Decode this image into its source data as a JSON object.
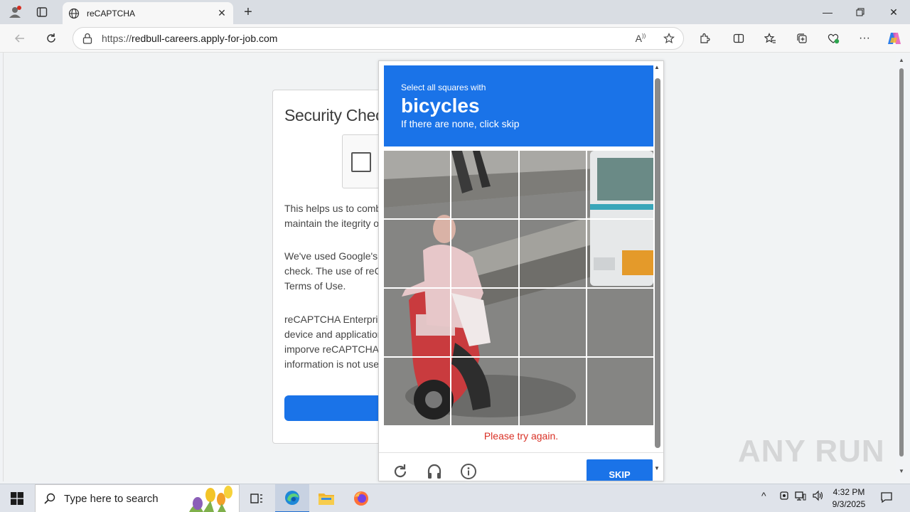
{
  "browser": {
    "tab_title": "reCAPTCHA",
    "url_prefix": "https://",
    "url_host": "redbull-careers.apply-for-job.com"
  },
  "page": {
    "card_title": "Security Check",
    "para1_line1": "This helps us to comba",
    "para1_line2": "maintain the itegrity of",
    "para2_line1": "We've used Google's r",
    "para2_line2": "check. The use of reCA",
    "para2_line3": "Terms of Use.",
    "para3_line1": "reCAPTCHA Enterpris",
    "para3_line2": "device and application",
    "para3_line3": "imporve reCAPTCHA l",
    "para3_line4": "information is not used"
  },
  "challenge": {
    "instruction": "Select all squares with",
    "keyword": "bicycles",
    "hint": "If there are none, click skip",
    "error": "Please try again.",
    "skip_label": "SKIP",
    "grid_rows": 4,
    "grid_cols": 4
  },
  "taskbar": {
    "search_placeholder": "Type here to search",
    "time": "4:32 PM",
    "date": "9/3/2025"
  },
  "watermark": "ANY RUN",
  "colors": {
    "accent": "#1a73e8",
    "error": "#d93025"
  }
}
